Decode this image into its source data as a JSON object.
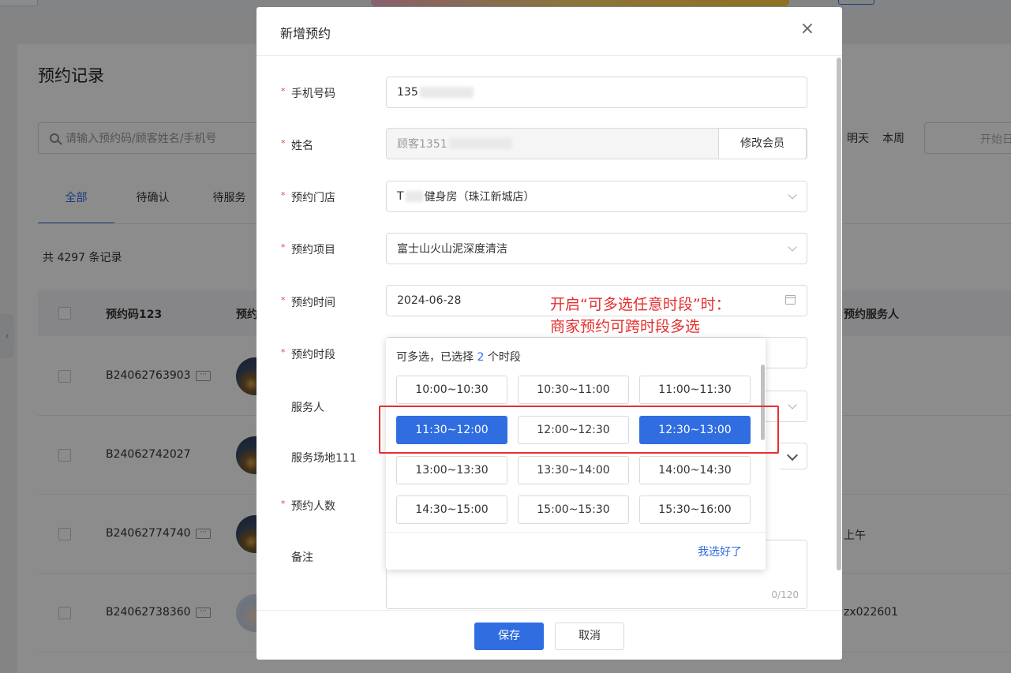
{
  "background": {
    "page_title": "预约记录",
    "search_placeholder": "请输入预约码/顾客姓名/手机号",
    "quick_dates": [
      "明天",
      "本周"
    ],
    "date_start_placeholder": "开始日",
    "tabs": [
      "全部",
      "待确认",
      "待服务"
    ],
    "active_tab": "全部",
    "record_count": "共 4297 条记录",
    "columns": [
      "预约码123",
      "预约",
      "预约服务人"
    ],
    "rows": [
      {
        "code": "B24062763903",
        "extra": ""
      },
      {
        "code": "B24062742027",
        "extra": ""
      },
      {
        "code": "B24062774740",
        "extra": "上午"
      },
      {
        "code": "B24062738360",
        "extra": "zx022601"
      }
    ],
    "more_glyph": "···",
    "collapse_glyph": "‹"
  },
  "modal": {
    "title": "新增预约",
    "close_glyph": "×",
    "fields": {
      "phone_label": "手机号码",
      "phone_value": "135",
      "name_label": "姓名",
      "name_value": "顾客1351",
      "edit_member": "修改会员",
      "store_label": "预约门店",
      "store_prefix": "T",
      "store_value": "健身房（珠江新城店）",
      "project_label": "预约项目",
      "project_value": "富士山火山泥深度清洁",
      "time_label": "预约时间",
      "time_value": "2024-06-28",
      "slot_label": "预约时段",
      "server_label": "服务人",
      "venue_label": "服务场地111",
      "people_label": "预约人数",
      "remark_label": "备注",
      "remark_counter": "0/120"
    },
    "required_mark": "*",
    "save": "保存",
    "cancel": "取消"
  },
  "slot_picker": {
    "head_prefix": "可多选，已选择",
    "selected_count": "2",
    "head_suffix": "个时段",
    "slots": [
      {
        "label": "10:00~10:30",
        "selected": false
      },
      {
        "label": "10:30~11:00",
        "selected": false
      },
      {
        "label": "11:00~11:30",
        "selected": false
      },
      {
        "label": "11:30~12:00",
        "selected": true
      },
      {
        "label": "12:00~12:30",
        "selected": false
      },
      {
        "label": "12:30~13:00",
        "selected": true
      },
      {
        "label": "13:00~13:30",
        "selected": false
      },
      {
        "label": "13:30~14:00",
        "selected": false
      },
      {
        "label": "14:00~14:30",
        "selected": false
      },
      {
        "label": "14:30~15:00",
        "selected": false
      },
      {
        "label": "15:00~15:30",
        "selected": false
      },
      {
        "label": "15:30~16:00",
        "selected": false
      }
    ],
    "done": "我选好了"
  },
  "annotation": {
    "line1": "开启“可多选任意时段”时：",
    "line2": "商家预约可跨时段多选",
    "color": "#e53030"
  },
  "colors": {
    "primary": "#2f6de1",
    "required": "#e54545"
  }
}
